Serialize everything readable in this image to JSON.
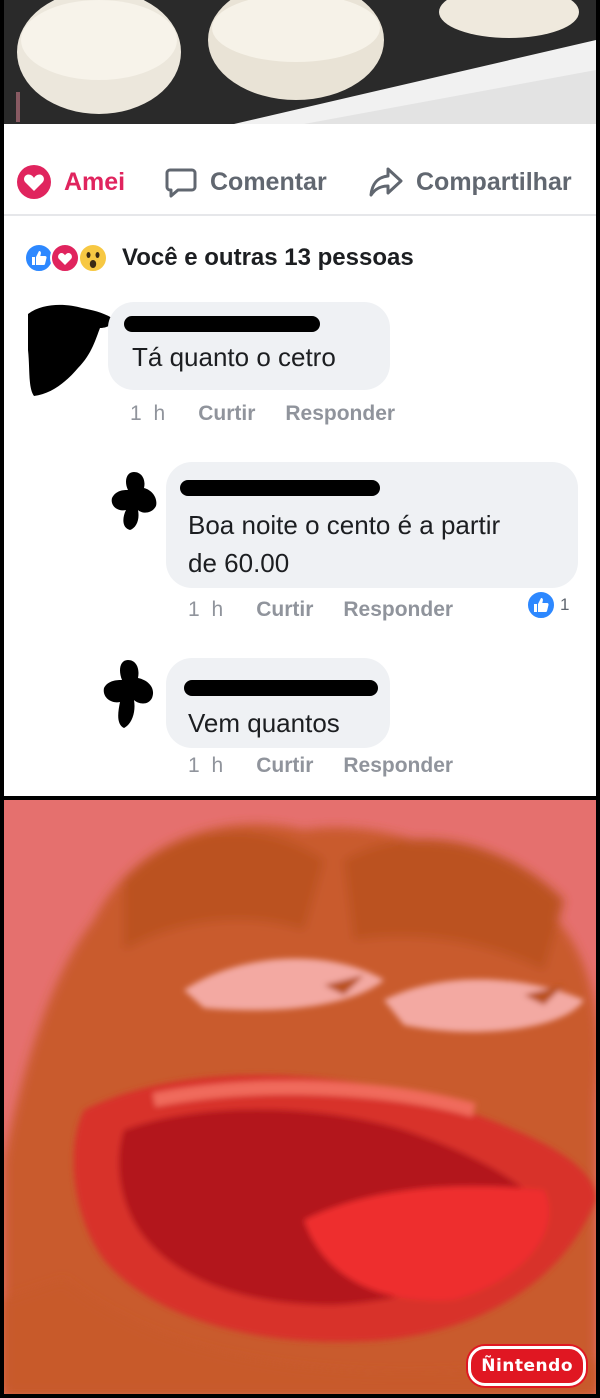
{
  "post": {
    "actions": {
      "love_label": "Amei",
      "comment_label": "Comentar",
      "share_label": "Compartilhar"
    },
    "reactions_summary": "Você e outras 13 pessoas",
    "reaction_icons": [
      "like-icon",
      "love-icon",
      "wow-icon"
    ]
  },
  "comments": [
    {
      "text": "Tá quanto o cetro",
      "time": "1 h",
      "like_label": "Curtir",
      "reply_label": "Responder"
    },
    {
      "text": "Boa noite o cento é a partir\nde 60.00",
      "time": "1 h",
      "like_label": "Curtir",
      "reply_label": "Responder",
      "likes": "1"
    },
    {
      "text": "Vem quantos",
      "time": "1 h",
      "like_label": "Curtir",
      "reply_label": "Responder"
    }
  ],
  "watermark": "Ñintendo",
  "colors": {
    "love": "#e0245e",
    "like": "#2d88ff",
    "meta": "#90949c",
    "bubble": "#eff1f4",
    "meme_bg": "#e5706e"
  }
}
